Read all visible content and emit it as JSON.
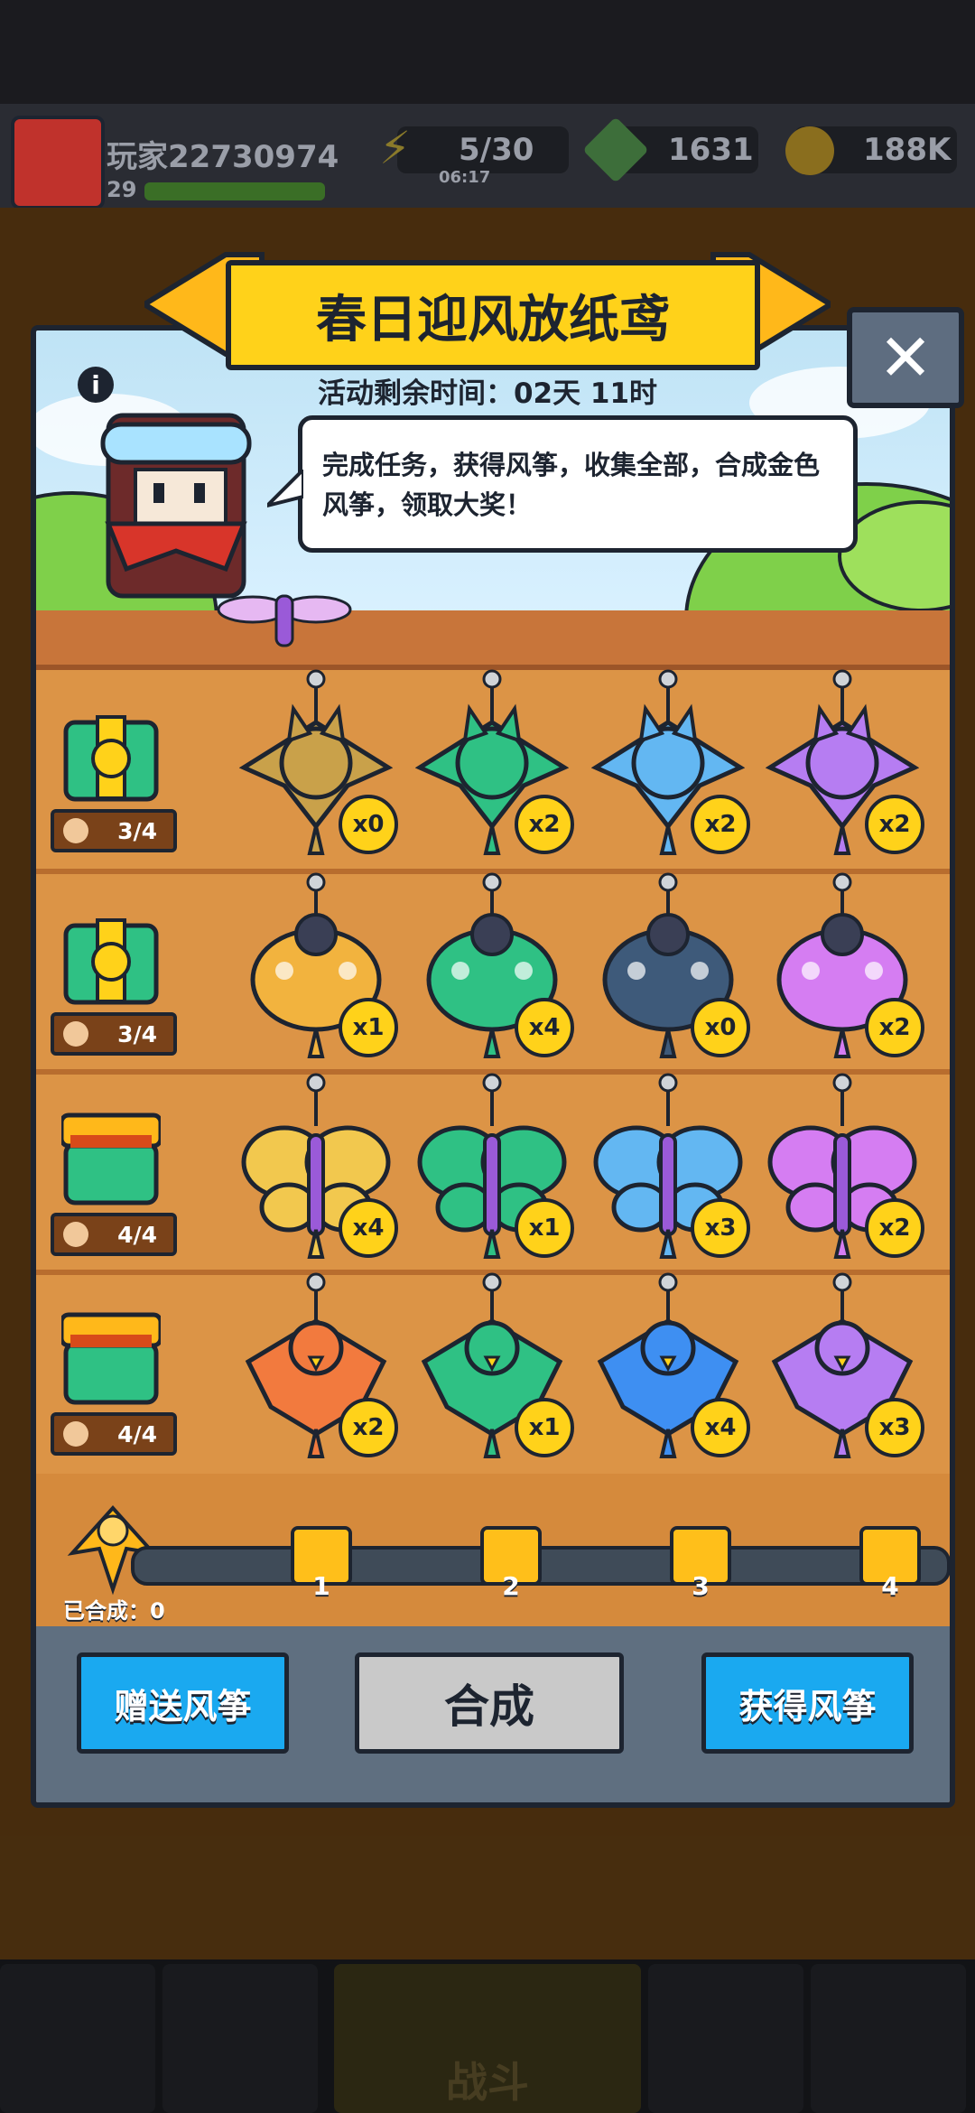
{
  "hud": {
    "player_name": "玩家22730974",
    "level": "29",
    "energy": "5/30",
    "energy_timer": "06:17",
    "gems": "1631",
    "gold": "188K"
  },
  "event": {
    "title": "春日迎风放纸鸢",
    "timer": "活动剩余时间：02天 11时",
    "description": "完成任务，获得风筝，收集全部，合成金色风筝，领取大奖！",
    "close_symbol": "✕",
    "info_symbol": "i"
  },
  "rows": [
    {
      "chest_progress": "3/4",
      "kites": [
        {
          "count": "x0",
          "color": "#c9a14a"
        },
        {
          "count": "x2",
          "color": "#2fc184"
        },
        {
          "count": "x2",
          "color": "#63b7f2"
        },
        {
          "count": "x2",
          "color": "#b67df2"
        }
      ]
    },
    {
      "chest_progress": "3/4",
      "kites": [
        {
          "count": "x1",
          "color": "#f2b33e"
        },
        {
          "count": "x4",
          "color": "#2fc184"
        },
        {
          "count": "x0",
          "color": "#3e5a7a"
        },
        {
          "count": "x2",
          "color": "#d57df2"
        }
      ]
    },
    {
      "chest_progress": "4/4",
      "kites": [
        {
          "count": "x4",
          "color": "#f2c84e"
        },
        {
          "count": "x1",
          "color": "#2fc184"
        },
        {
          "count": "x3",
          "color": "#63b7f2"
        },
        {
          "count": "x2",
          "color": "#d57df2"
        }
      ]
    },
    {
      "chest_progress": "4/4",
      "kites": [
        {
          "count": "x2",
          "color": "#f27a3e"
        },
        {
          "count": "x1",
          "color": "#2fc184"
        },
        {
          "count": "x4",
          "color": "#3e8ff2"
        },
        {
          "count": "x3",
          "color": "#b67df2"
        }
      ]
    }
  ],
  "progress": {
    "synth_label": "已合成：0",
    "milestones": [
      "1",
      "2",
      "3",
      "4"
    ]
  },
  "buttons": {
    "gift": "赠送风筝",
    "synthesize": "合成",
    "obtain": "获得风筝"
  },
  "nav": {
    "battle": "战斗"
  }
}
